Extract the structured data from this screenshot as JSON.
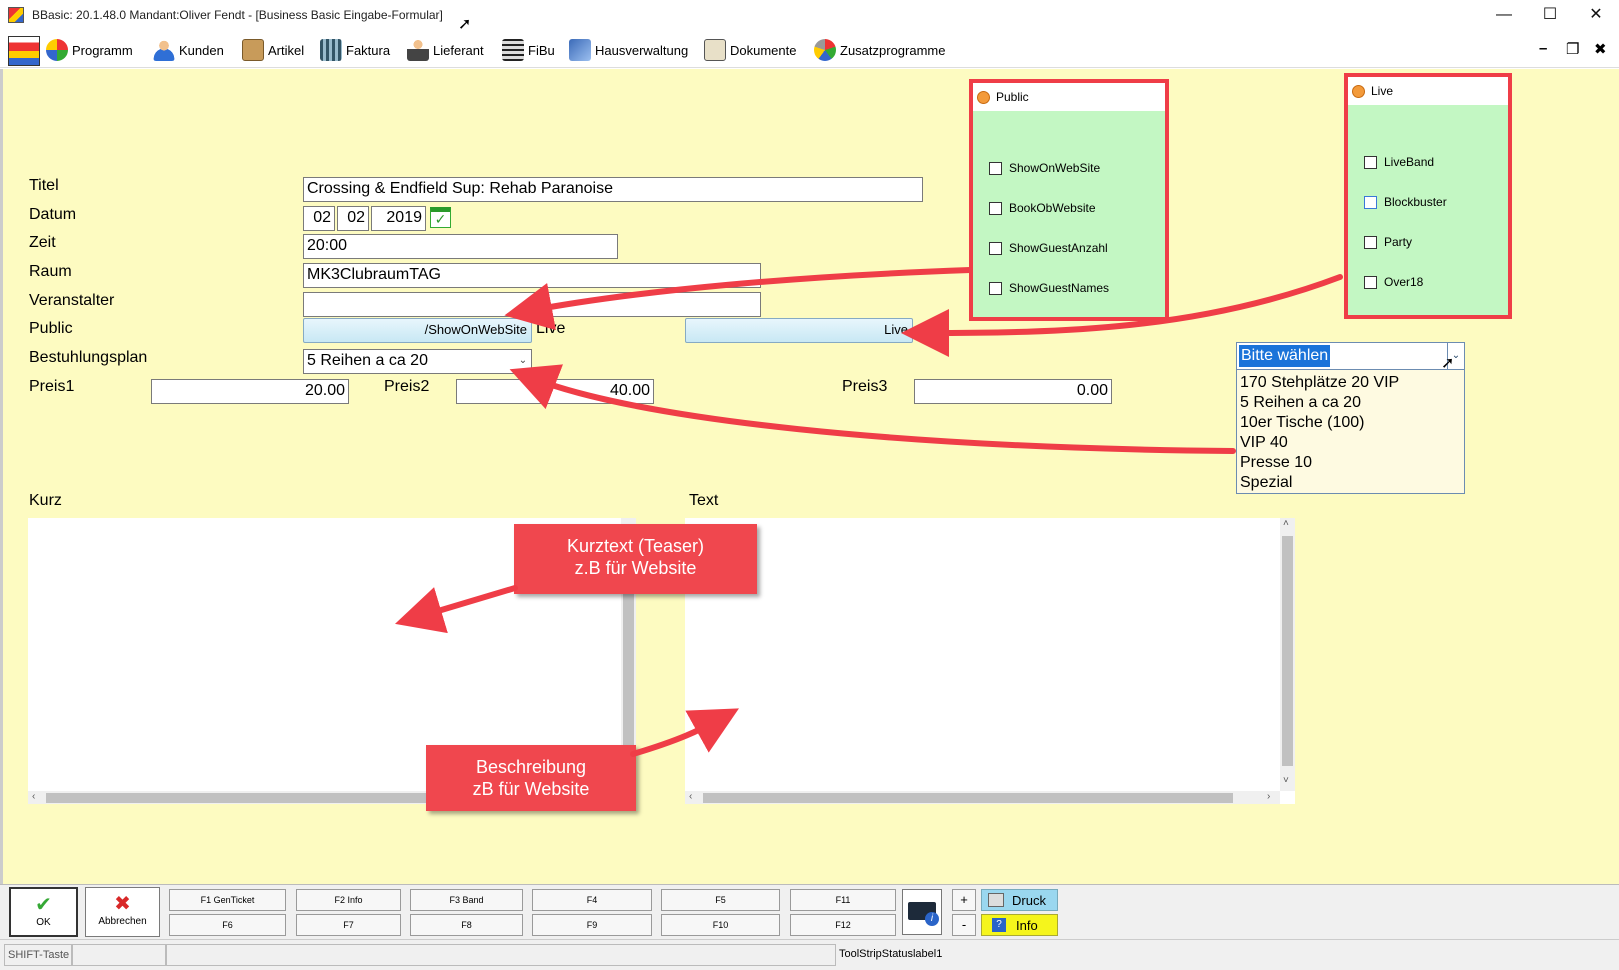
{
  "window": {
    "title": "BBasic: 20.1.48.0 Mandant:Oliver Fendt  - [Business Basic Eingabe-Formular]",
    "minimize": "—",
    "maximize": "☐",
    "close": "✕"
  },
  "menu": {
    "items": [
      "Programm",
      "Kunden",
      "Artikel",
      "Faktura",
      "Lieferant",
      "FiBu",
      "Hausverwaltung",
      "Dokumente",
      "Zusatzprogramme"
    ],
    "mdi_minimize": "–",
    "mdi_restore": "❐",
    "mdi_close": "✖"
  },
  "form": {
    "titel_label": "Titel",
    "titel_value": "Crossing & Endfield Sup: Rehab Paranoise",
    "datum_label": "Datum",
    "datum_day": "02",
    "datum_month": "02",
    "datum_year": "2019",
    "zeit_label": "Zeit",
    "zeit_value": "20:00",
    "raum_label": "Raum",
    "raum_value": "MK3ClubraumTAG",
    "veranstalter_label": "Veranstalter",
    "veranstalter_value": "",
    "public_label": "Public",
    "public_value": "/ShowOnWebSite",
    "live_label": "Live",
    "live_value": "Live",
    "bestuhlung_label": "Bestuhlungsplan",
    "bestuhlung_value": "5 Reihen a ca 20",
    "preis1_label": "Preis1",
    "preis1_value": "20.00",
    "preis2_label": "Preis2",
    "preis2_value": "40.00",
    "preis3_label": "Preis3",
    "preis3_value": "0.00",
    "kurz_label": "Kurz",
    "text_label": "Text"
  },
  "panel_public": {
    "title": "Public",
    "options": [
      "ShowOnWebSite",
      "BookObWebsite",
      "ShowGuestAnzahl",
      "ShowGuestNames"
    ]
  },
  "panel_live": {
    "title": "Live",
    "options": [
      "LiveBand",
      "Blockbuster",
      "Party",
      "Over18"
    ]
  },
  "dropdown": {
    "selected": "Bitte wählen",
    "options": [
      "170 Stehplätze 20 VIP",
      "5 Reihen a ca 20",
      "10er Tische (100)",
      "VIP 40",
      "Presse 10",
      "Spezial"
    ]
  },
  "callouts": {
    "kurz_line1": "Kurztext (Teaser)",
    "kurz_line2": "z.B für Website",
    "text_line1": "Beschreibung",
    "text_line2": "zB für Website"
  },
  "toolbar": {
    "ok": "OK",
    "abbrechen": "Abbrechen",
    "f_top": [
      "F1 GenTicket",
      "F2 Info",
      "F3 Band",
      "F4",
      "F5",
      "F11"
    ],
    "f_bottom": [
      "F6",
      "F7",
      "F8",
      "F9",
      "F10",
      "F12"
    ],
    "plus": "+",
    "minus": "-",
    "druck": "Druck",
    "info": "Info"
  },
  "status": {
    "shift": "SHIFT-Taste",
    "label1": "ToolStripStatuslabel1"
  },
  "colors": {
    "form_bg": "#fdfbc1",
    "panel_bg": "#c3f7c3",
    "highlight_red": "#ef3d47",
    "selection_blue": "#1a73d9"
  }
}
